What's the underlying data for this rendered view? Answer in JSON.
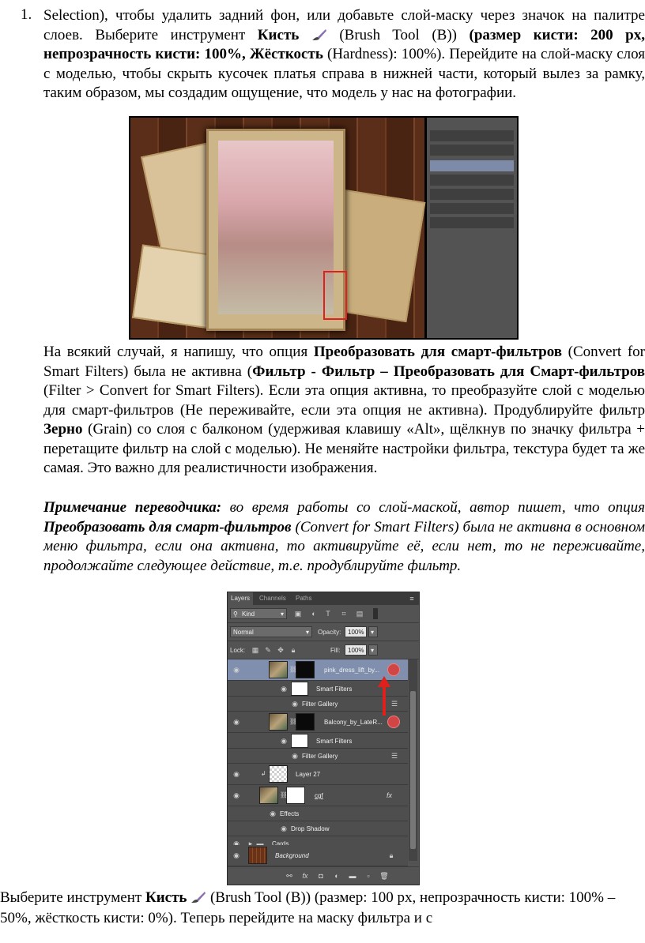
{
  "step1": {
    "number": "1.",
    "t1": "Selection), чтобы удалить задний фон, или добавьте слой-маску через значок на палитре слоев. Выберите инструмент ",
    "brush_label": "Кисть",
    "t2": " (Brush Tool (B)) ",
    "t3": "(размер кисти: 200 px, непрозрачность кисти: 100%, ",
    "hardness_label": "Жёсткость",
    "t4": " (Hardness): 100%). Перейдите на слой-маску слоя с моделью, чтобы скрыть кусочек платья справа в нижней части, который вылез за рамку, таким образом, мы создадим ощущение, что модель у нас на фотографии."
  },
  "step2": {
    "t1": "На всякий случай, я напишу, что опция ",
    "b1": "Преобразовать для смарт-фильтров",
    "t2": " (Convert for Smart Filters) была не активна (",
    "b2": "Фильтр - Фильтр – Преобразовать для Смарт-фильтров",
    "t3": " (Filter > Convert for Smart Filters). Если эта опция активна, то преобразуйте слой с моделью для смарт-фильтров (Не переживайте, если эта опция не активна). Продублируйте фильтр ",
    "b3": "Зерно",
    "t4": " (Grain) со слоя с балконом (удерживая клавишу «Alt», щёлкнув по значку фильтра + перетащите фильтр на слой с моделью). Не меняйте настройки фильтра, текстура будет та же самая. Это важно для реалистичности изображения."
  },
  "note": {
    "label": "Примечание переводчика:",
    "t1": " во время работы со слой-маской, автор пишет, что опция ",
    "b1": "Преобразовать для смарт-фильтров",
    "t2": " (Convert for Smart Filters) была не активна в основном меню фильтра, если она активна, то активируйте её, если нет, то не переживайте, продолжайте следующее действие, т.е. продублируйте фильтр."
  },
  "bottom": {
    "t1": "Выберите инструмент ",
    "brush_label": "Кисть",
    "t2": " (Brush Tool (B)) (размер: 100 px, непрозрачность кисти: 100% – 50%, жёсткость кисти: 0%). Теперь перейдите на маску фильтра и с"
  },
  "panel": {
    "tabs": [
      "Layers",
      "Channels",
      "Paths"
    ],
    "kind": "Kind",
    "blend_mode": "Normal",
    "opacity_label": "Opacity:",
    "opacity_value": "100%",
    "lock_label": "Lock:",
    "fill_label": "Fill:",
    "fill_value": "100%",
    "layers": {
      "model": "pink_dress_lift_by...",
      "smart_filters": "Smart Filters",
      "filter_gallery": "Filter Gallery",
      "balcony": "Balcony_by_LateR...",
      "layer27": "Layer 27",
      "cgf": "cgf",
      "effects": "Effects",
      "drop_shadow": "Drop Shadow",
      "cards": "Cards",
      "background": "Background"
    },
    "accent_color": "#e0201a"
  }
}
